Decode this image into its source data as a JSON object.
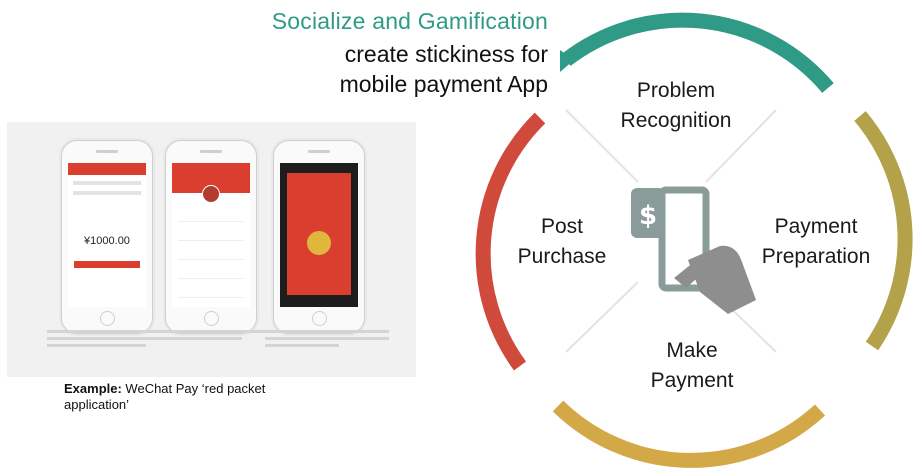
{
  "heading": {
    "accent": "Socialize and Gamification",
    "line1": "create stickiness for",
    "line2": "mobile payment App"
  },
  "example": {
    "label": "Example:",
    "text": " WeChat Pay ‘red packet application’",
    "phone_amount": "¥1000.00"
  },
  "stages": {
    "top": [
      "Problem",
      "Recognition"
    ],
    "right": [
      "Payment",
      "Preparation"
    ],
    "bottom": [
      "Make",
      "Payment"
    ],
    "left": [
      "Post",
      "Purchase"
    ]
  },
  "center_icon": "phone-with-dollar-icon",
  "colors": {
    "accent_teal": "#2f9a85",
    "arc_red": "#d04a3c",
    "arc_olive": "#b3a24a",
    "arc_gold": "#d3a846",
    "icon_gray": "#8a9c9a",
    "divider": "#e3e3e3"
  }
}
